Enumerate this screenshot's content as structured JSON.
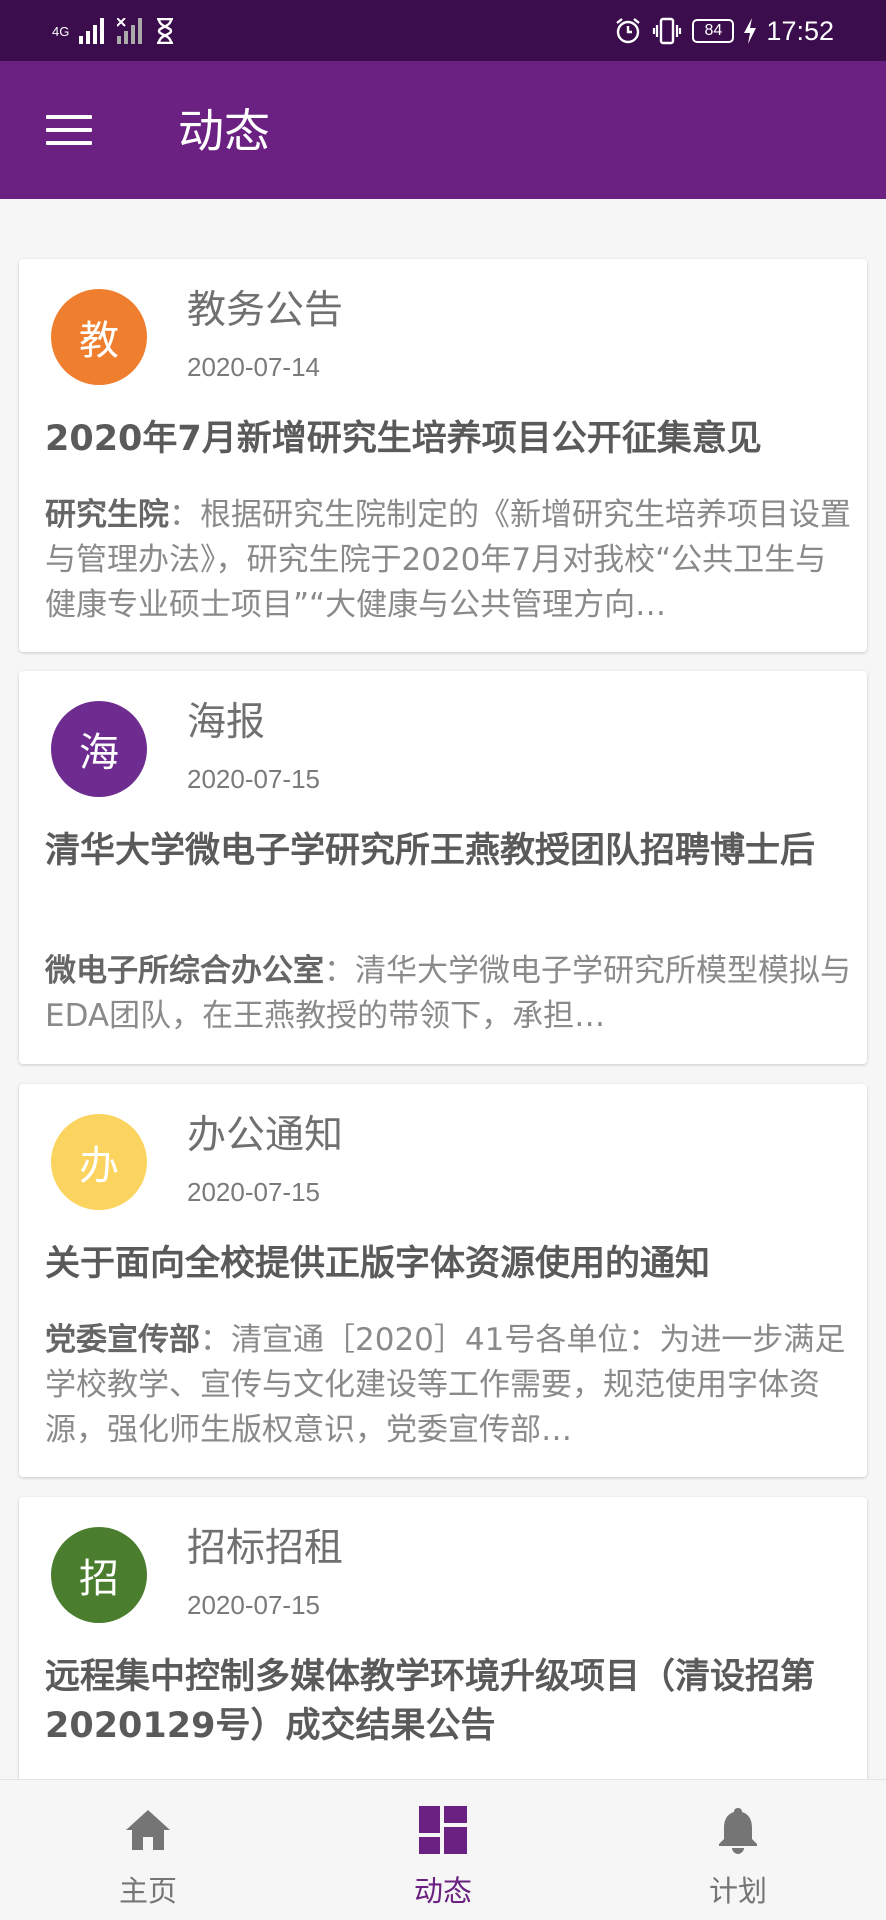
{
  "status_bar": {
    "network": "4G",
    "time": "17:52",
    "battery": "84"
  },
  "app_bar": {
    "title": "动态"
  },
  "feed": [
    {
      "avatar_char": "教",
      "avatar_color": "#ef7f2f",
      "category": "教务公告",
      "date": "2020-07-14",
      "title": "2020年7月新增研究生培养项目公开征集意见",
      "source": "研究生院",
      "summary": "：根据研究生院制定的《新增研究生培养项目设置与管理办法》，研究生院于2020年7月对我校“公共卫生与健康专业硕士项目”“大健康与公共管理方向…"
    },
    {
      "avatar_char": "海",
      "avatar_color": "#6e2c91",
      "category": "海报",
      "date": "2020-07-15",
      "title": "清华大学微电子学研究所王燕教授团队招聘博士后",
      "source": "微电子所综合办公室",
      "summary": "：清华大学微电子学研究所模型模拟与EDA团队，在王燕教授的带领下，承担…"
    },
    {
      "avatar_char": "办",
      "avatar_color": "#fbd45f",
      "category": "办公通知",
      "date": "2020-07-15",
      "title": "关于面向全校提供正版字体资源使用的通知",
      "source": "党委宣传部",
      "summary": "：清宣通［2020］41号各单位：为进一步满足学校教学、宣传与文化建设等工作需要，规范使用字体资源，强化师生版权意识，党委宣传部…"
    },
    {
      "avatar_char": "招",
      "avatar_color": "#4a7e2e",
      "category": "招标招租",
      "date": "2020-07-15",
      "title": "远程集中控制多媒体教学环境升级项目（清设招第2020129号）成交结果公告"
    }
  ],
  "bottom_nav": {
    "items": [
      {
        "label": "主页",
        "icon": "home-icon",
        "active": false
      },
      {
        "label": "动态",
        "icon": "dashboard-icon",
        "active": true
      },
      {
        "label": "计划",
        "icon": "bell-icon",
        "active": false
      }
    ],
    "active_color": "#6b2181",
    "inactive_color": "#757575"
  }
}
